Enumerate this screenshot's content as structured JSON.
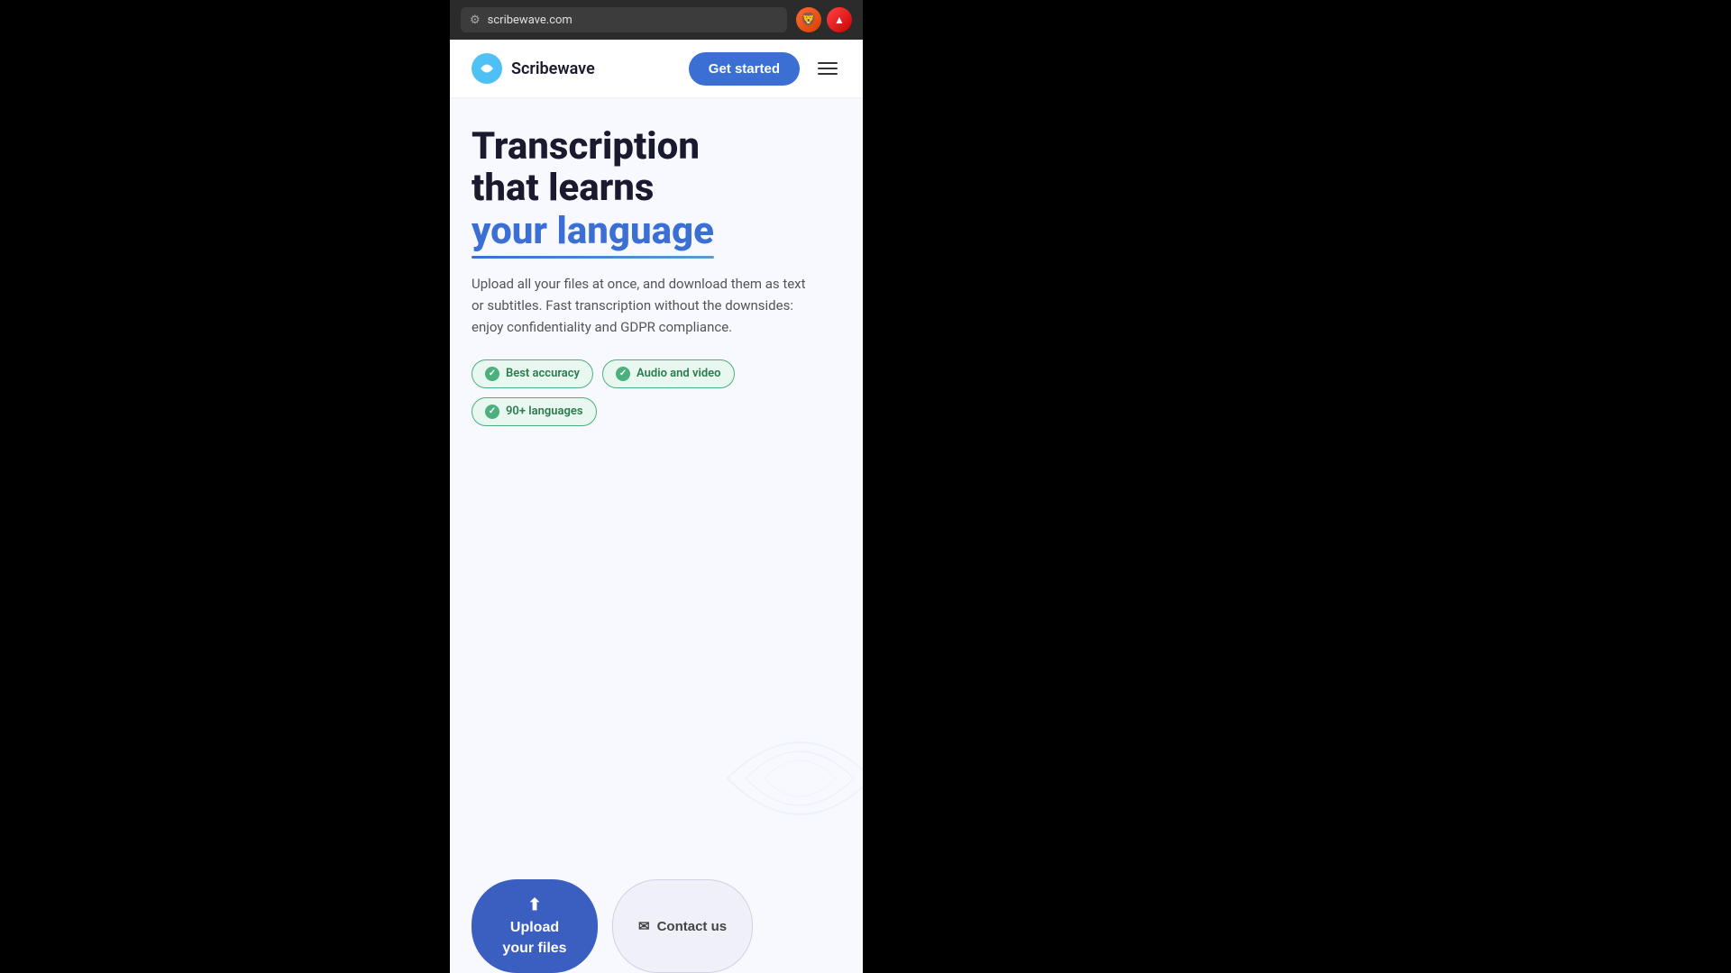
{
  "browser": {
    "url": "scribewave.com",
    "address_icon": "🔒"
  },
  "navbar": {
    "logo_text": "Scribewave",
    "get_started_label": "Get started",
    "menu_label": "Menu"
  },
  "hero": {
    "title_line1": "Transcription",
    "title_line2": "that learns",
    "title_line3": "your language",
    "description": "Upload all your files at once, and download them as text or subtitles. Fast transcription without the downsides: enjoy confidentiality and GDPR compliance.",
    "badge1": "Best accuracy",
    "badge2": "Audio and video",
    "badge3": "90+ languages"
  },
  "cta": {
    "upload_label_line1": "Upload",
    "upload_label_line2": "your files",
    "upload_icon": "⬆",
    "contact_label": "Contact us",
    "contact_icon": "✉"
  }
}
